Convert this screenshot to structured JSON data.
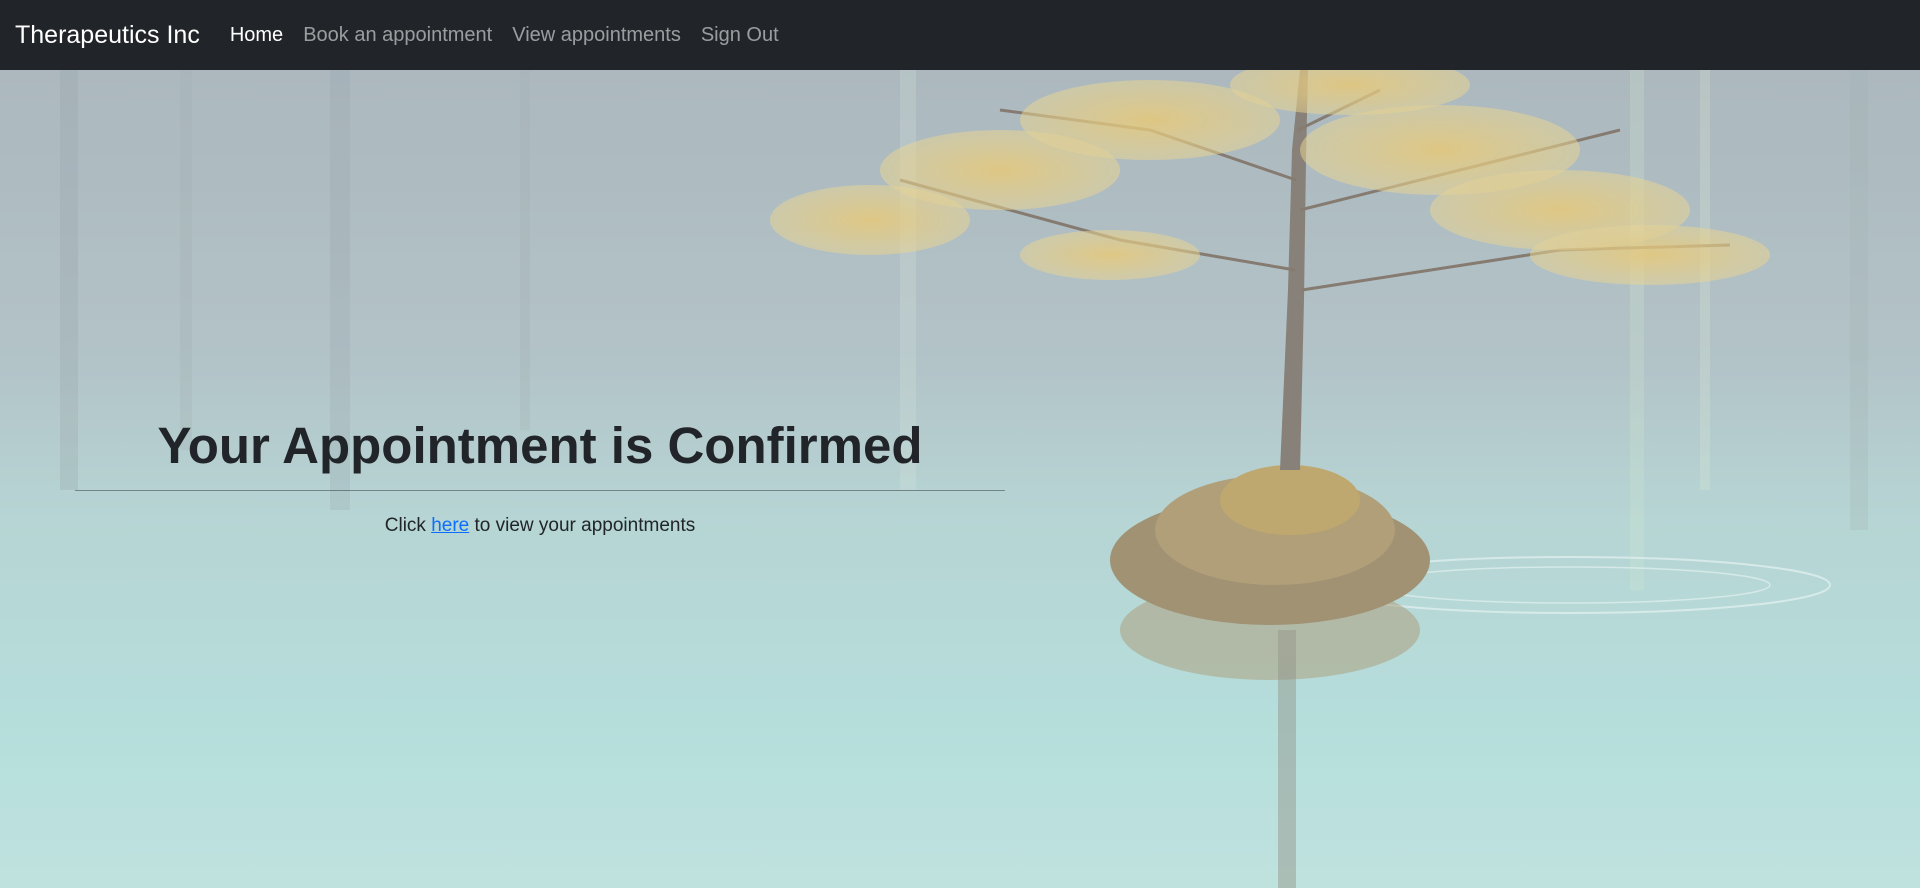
{
  "navbar": {
    "brand": "Therapeutics Inc",
    "links": [
      {
        "label": "Home",
        "active": true
      },
      {
        "label": "Book an appointment",
        "active": false
      },
      {
        "label": "View appointments",
        "active": false
      },
      {
        "label": "Sign Out",
        "active": false
      }
    ]
  },
  "main": {
    "title": "Your Appointment is Confirmed",
    "message_prefix": "Click",
    "link_text": "here",
    "message_suffix": "to view your appointments"
  },
  "background": {
    "description_icon": "tree-on-island-in-lake-image"
  },
  "colors": {
    "navbar_bg": "#212529",
    "link": "#0d6efd",
    "text": "#212529"
  }
}
